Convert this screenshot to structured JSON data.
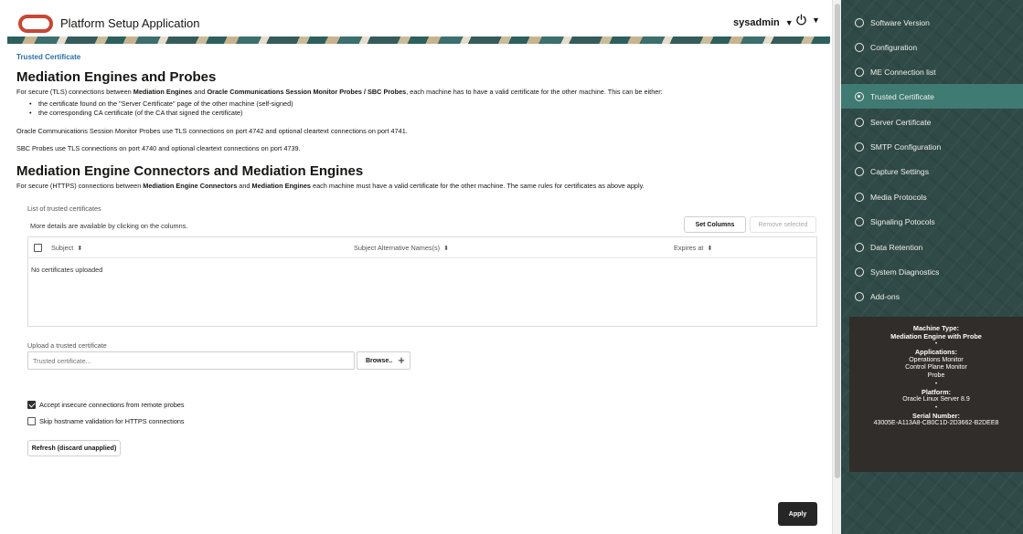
{
  "header": {
    "app_title": "Platform Setup Application",
    "user": "sysadmin"
  },
  "main": {
    "breadcrumb": "Trusted Certificate",
    "section1": {
      "title": "Mediation Engines and Probes",
      "intro_pre": "For secure (TLS) connections between ",
      "intro_b1": "Mediation Engines",
      "intro_mid": " and ",
      "intro_b2": "Oracle Communications Session Monitor Probes / SBC Probes",
      "intro_post": ", each machine has to have a valid certificate for the other machine. This can be either:",
      "bullets": [
        "the certificate found on the \"Server Certificate\" page of the other machine (self-signed)",
        "the corresponding CA certificate (of the CA that signed the certificate)"
      ],
      "ocsm_note": "Oracle Communications Session Monitor Probes use TLS connections on port 4742 and optional cleartext connections on port 4741.",
      "sbc_note": "SBC Probes use TLS connections on port 4740 and optional cleartext connections on port 4739."
    },
    "section2": {
      "title": "Mediation Engine Connectors and Mediation Engines",
      "intro_pre": "For secure (HTTPS) connections between ",
      "intro_b1": "Mediation Engine Connectors",
      "intro_mid": " and ",
      "intro_b2": "Mediation Engines",
      "intro_post": " each machine must have a valid certificate for the other machine. The same rules for certificates as above apply."
    },
    "list": {
      "label": "List of trusted certificates",
      "hint": "More details are available by clicking on the columns.",
      "set_columns": "Set Columns",
      "remove_selected": "Remove selected",
      "columns": [
        "Subject",
        "Subject Alternative Names(s)",
        "Expires at"
      ],
      "empty": "No certificates uploaded"
    },
    "upload": {
      "label": "Upload a trusted certificate",
      "placeholder": "Trusted certificate...",
      "browse": "Browse.."
    },
    "options": {
      "accept_insecure": "Accept insecure connections from remote probes",
      "accept_insecure_checked": true,
      "skip_hostname": "Skip hostname validation for HTTPS connections",
      "skip_hostname_checked": false
    },
    "refresh": "Refresh (discard unapplied)",
    "apply": "Apply"
  },
  "sidebar": {
    "items": [
      {
        "label": "Software Version",
        "active": false
      },
      {
        "label": "Configuration",
        "active": false
      },
      {
        "label": "ME Connection list",
        "active": false
      },
      {
        "label": "Trusted Certificate",
        "active": true
      },
      {
        "label": "Server Certificate",
        "active": false
      },
      {
        "label": "SMTP Configuration",
        "active": false
      },
      {
        "label": "Capture Settings",
        "active": false
      },
      {
        "label": "Media Protocols",
        "active": false
      },
      {
        "label": "Signaling Potocols",
        "active": false
      },
      {
        "label": "Data Retention",
        "active": false
      },
      {
        "label": "System Diagnostics",
        "active": false
      },
      {
        "label": "Add-ons",
        "active": false
      }
    ],
    "info": {
      "machine_type_label": "Machine Type:",
      "machine_type": "Mediation Engine with Probe",
      "applications_label": "Applications:",
      "applications": [
        "Operations Monitor",
        "Control Plane Monitor",
        "Probe"
      ],
      "platform_label": "Platform:",
      "platform": "Oracle Linux Server 8.9",
      "serial_label": "Serial Number:",
      "serial": "43005E-A113A8-CB0C1D-2D3662-B2DEE8",
      "separator": "•"
    }
  },
  "colors": {
    "brand_red": "#c74634",
    "sidebar_bg": "#2f4a47",
    "sidebar_active": "#3f7a73",
    "info_card_bg": "#312d2a",
    "link_blue": "#2b6fa8"
  },
  "icons": {
    "logo": "oracle-logo-icon",
    "user_caret": "chevron-down-icon",
    "power": "power-icon",
    "sort": "sort-icon",
    "add": "plus-icon",
    "nav_radio": "radio-icon"
  }
}
